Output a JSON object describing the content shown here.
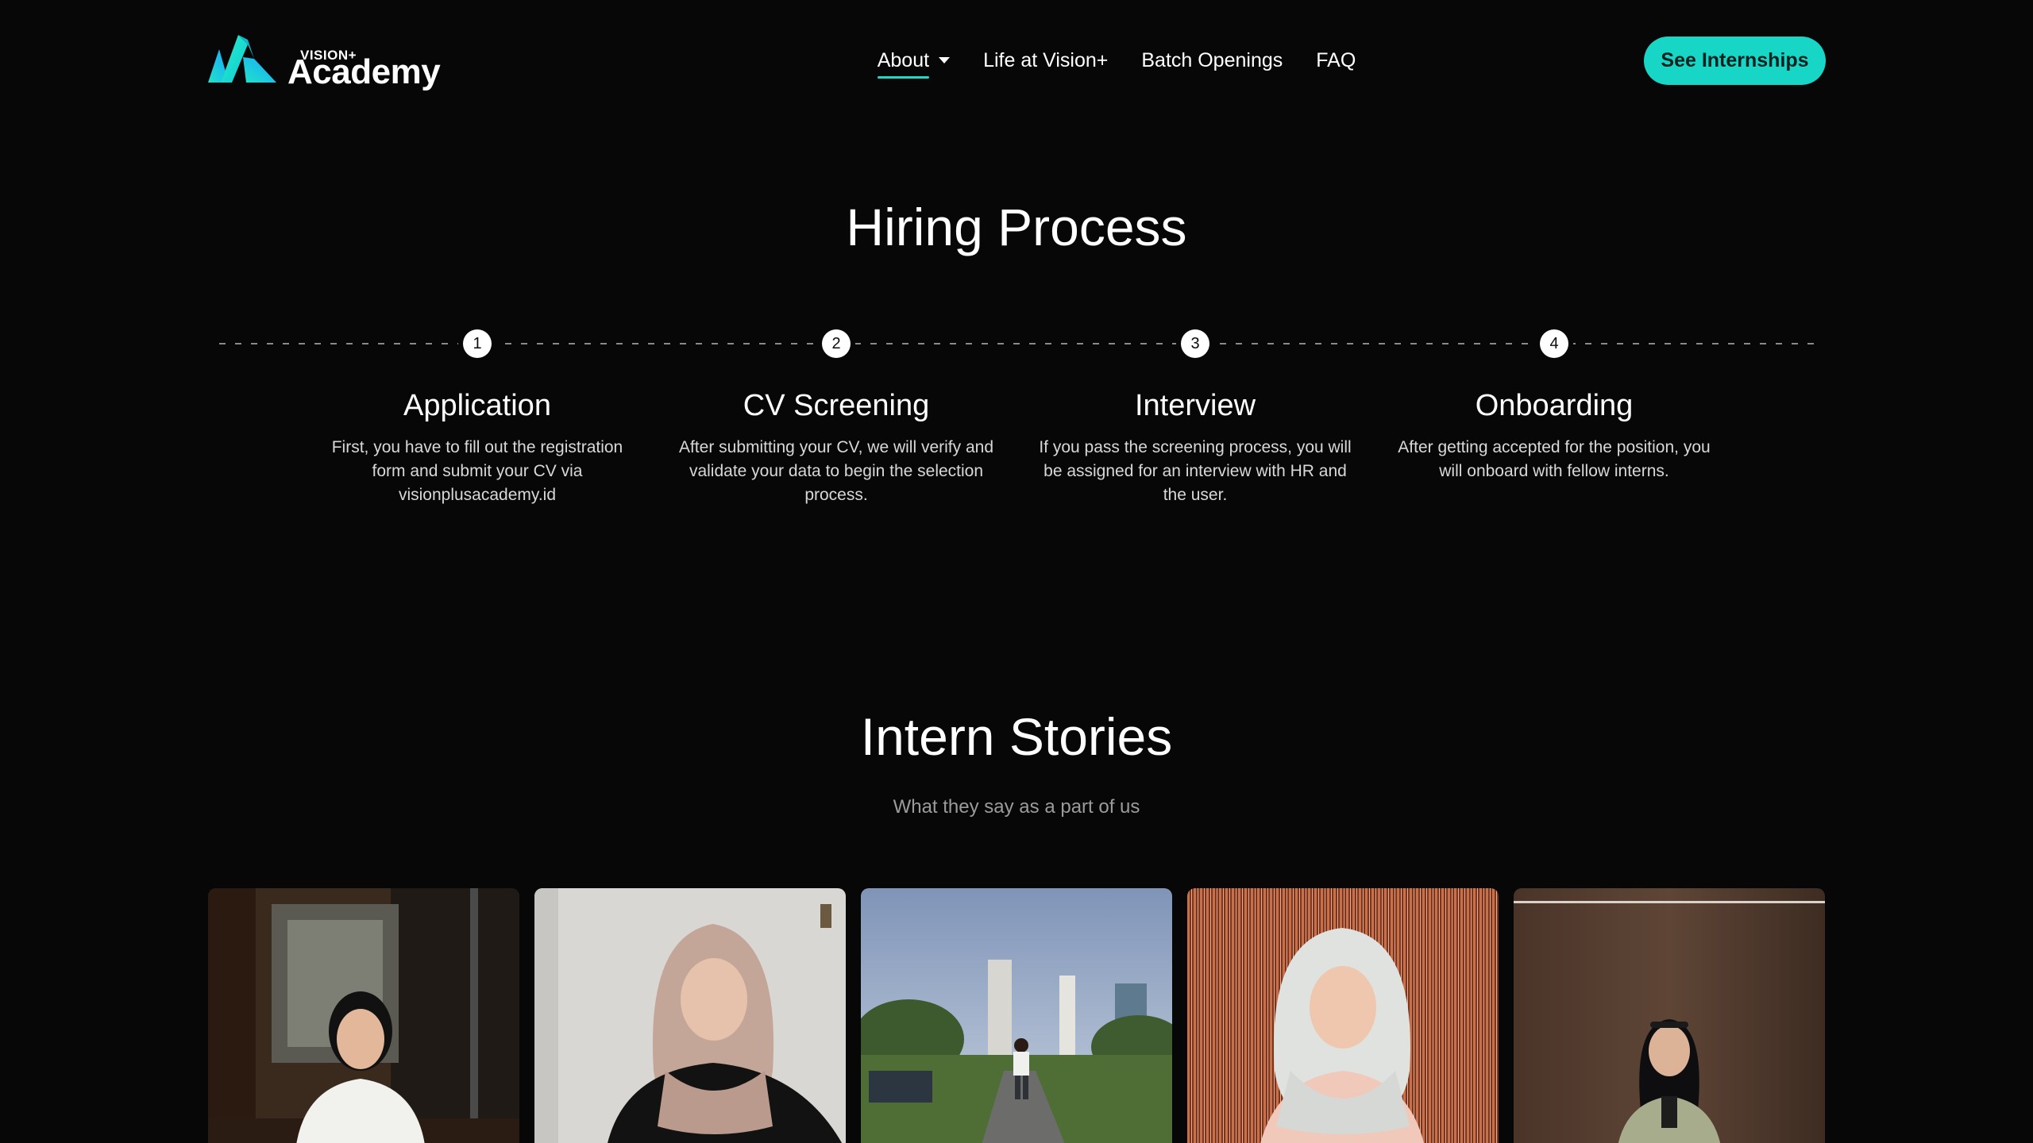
{
  "header": {
    "logo_small": "VISION+",
    "logo_big": "Academy",
    "nav": [
      {
        "label": "About"
      },
      {
        "label": "Life at Vision+"
      },
      {
        "label": "Batch Openings"
      },
      {
        "label": "FAQ"
      }
    ],
    "cta_label": "See Internships"
  },
  "colors": {
    "background": "#070707",
    "accent": "#17d6c6"
  },
  "hiring_process": {
    "title": "Hiring Process",
    "steps": [
      {
        "number": "1",
        "title": "Application",
        "description": "First, you have to fill out the registration form and submit your CV via visionplusacademy.id"
      },
      {
        "number": "2",
        "title": "CV Screening",
        "description": "After submitting your CV, we will verify and validate your data to begin the selection process."
      },
      {
        "number": "3",
        "title": "Interview",
        "description": "If you pass the screening process, you will be assigned for an interview with HR and the user."
      },
      {
        "number": "4",
        "title": "Onboarding",
        "description": "After getting accepted for the position, you will onboard with fellow interns."
      }
    ]
  },
  "intern_stories": {
    "title": "Intern Stories",
    "subtitle": "What they say as a part of us"
  }
}
